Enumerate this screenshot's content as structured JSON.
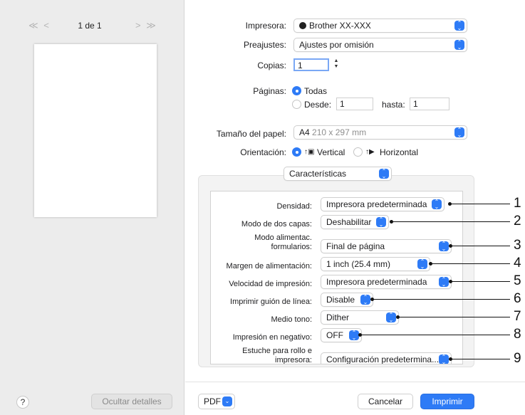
{
  "sidebar": {
    "page_indicator": "1 de 1",
    "first_prev": "≪ <",
    "next_last": "> ≫",
    "help": "?",
    "hide_details": "Ocultar detalles"
  },
  "printer": {
    "label": "Impresora:",
    "value": "Brother XX-XXX"
  },
  "presets": {
    "label": "Preajustes:",
    "value": "Ajustes por omisión"
  },
  "copies": {
    "label": "Copias:",
    "value": "1"
  },
  "pages": {
    "label": "Páginas:",
    "all": "Todas",
    "from_label": "Desde:",
    "from_value": "1",
    "to_label": "hasta:",
    "to_value": "1"
  },
  "paper_size": {
    "label": "Tamaño del papel:",
    "value_bold": "A4",
    "value_rest": "210 x 297 mm"
  },
  "orientation": {
    "label": "Orientación:",
    "portrait": "Vertical",
    "landscape": "Horizontal"
  },
  "section": {
    "value": "Características"
  },
  "features": [
    {
      "label": "Densidad:",
      "value": "Impresora predeterminada"
    },
    {
      "label": "Modo de dos capas:",
      "value": "Deshabilitar"
    },
    {
      "label": "Modo alimentac. formularios:",
      "value": "Final de página"
    },
    {
      "label": "Margen de alimentación:",
      "value": "1 inch (25.4 mm)"
    },
    {
      "label": "Velocidad de impresión:",
      "value": "Impresora predeterminada"
    },
    {
      "label": "Imprimir guión de línea:",
      "value": "Disable"
    },
    {
      "label": "Medio tono:",
      "value": "Dither"
    },
    {
      "label": "Impresión en negativo:",
      "value": "OFF"
    },
    {
      "label": "Estuche para rollo e impresora:",
      "value": "Configuración predetermina..."
    }
  ],
  "callouts": [
    "1",
    "2",
    "3",
    "4",
    "5",
    "6",
    "7",
    "8",
    "9"
  ],
  "bottom": {
    "pdf": "PDF",
    "cancel": "Cancelar",
    "print": "Imprimir"
  },
  "colors": {
    "accent": "#2e7bf6",
    "sidebar_bg": "#ececec"
  }
}
